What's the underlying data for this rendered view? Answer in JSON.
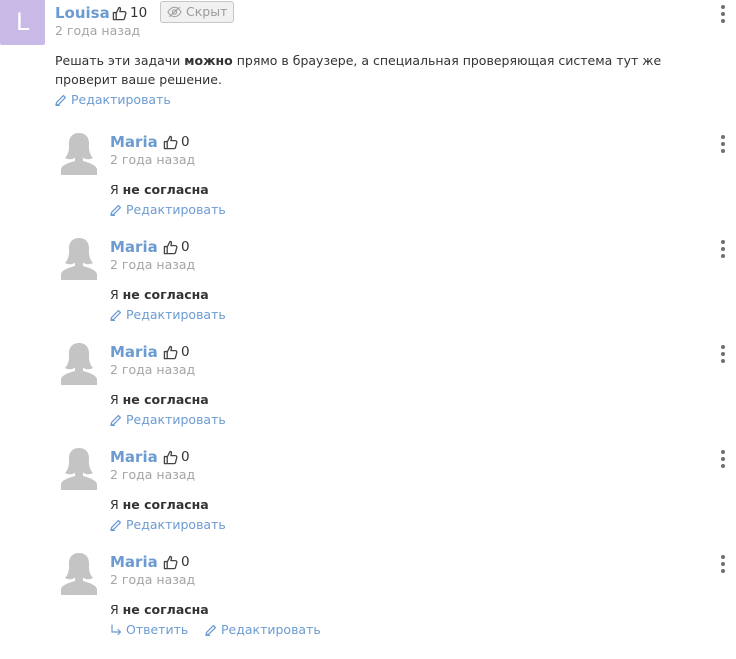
{
  "parent": {
    "avatar_letter": "L",
    "author": "Louisa",
    "likes": "10",
    "hidden_label": "Скрыт",
    "date": "2 года назад",
    "text_part1": "Решать эти задачи ",
    "text_bold": "можно",
    "text_part2": " прямо в браузере, а специальная проверяющая система тут же",
    "text_line2": "проверит ваше решение.",
    "edit_label": "Редактировать"
  },
  "replies": [
    {
      "author": "Maria",
      "likes": "0",
      "date": "2 года назад",
      "text_prefix": "Я ",
      "text_bold": "не согласна",
      "edit_label": "Редактировать"
    },
    {
      "author": "Maria",
      "likes": "0",
      "date": "2 года назад",
      "text_prefix": "Я ",
      "text_bold": "не согласна",
      "edit_label": "Редактировать"
    },
    {
      "author": "Maria",
      "likes": "0",
      "date": "2 года назад",
      "text_prefix": "Я ",
      "text_bold": "не согласна",
      "edit_label": "Редактировать"
    },
    {
      "author": "Maria",
      "likes": "0",
      "date": "2 года назад",
      "text_prefix": "Я ",
      "text_bold": "не согласна",
      "edit_label": "Редактировать"
    },
    {
      "author": "Maria",
      "likes": "0",
      "date": "2 года назад",
      "text_prefix": "Я ",
      "text_bold": "не согласна",
      "reply_label": "Ответить",
      "edit_label": "Редактировать"
    }
  ],
  "icons": {
    "like": "thumbs-up-icon",
    "hidden": "eye-off-icon",
    "edit": "pencil-icon",
    "reply": "reply-arrow-icon",
    "menu": "more-vertical-icon"
  },
  "colors": {
    "link": "#6c9bd2",
    "avatar_bg": "#c9b9e6",
    "silhouette": "#c4c4c4",
    "muted": "#a4a4a4"
  }
}
